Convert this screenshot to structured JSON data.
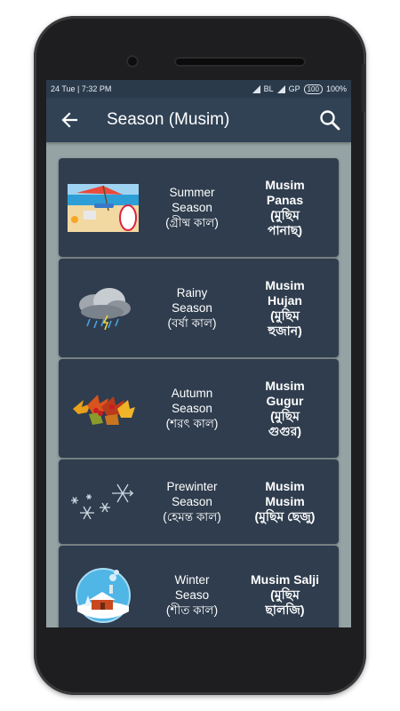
{
  "status_bar": {
    "left_text": "24 Tue | 7:32 PM",
    "carrier_1": "BL",
    "carrier_2": "GP",
    "battery_badge": "100",
    "battery_percent": "100%"
  },
  "app_bar": {
    "title": "Season (Musim)",
    "back_icon": "arrow-left",
    "search_icon": "magnifier"
  },
  "seasons": [
    {
      "image": "summer-beach-image",
      "english": [
        "Summer",
        "Season",
        "(গ্রীষ্ম কাল)"
      ],
      "name": [
        "Musim",
        "Panas",
        "(মুছিম",
        "পানাছ)"
      ]
    },
    {
      "image": "rain-cloud-image",
      "english": [
        "Rainy",
        "Season",
        "(বর্ষা কাল)"
      ],
      "name": [
        "Musim",
        "Hujan",
        "(মুছিম",
        "হুজান)"
      ]
    },
    {
      "image": "autumn-leaves-image",
      "english": [
        "Autumn",
        "Season",
        "(শরৎ কাল)"
      ],
      "name": [
        "Musim",
        "Gugur",
        "(মুছিম",
        "গুগুর)"
      ]
    },
    {
      "image": "snowflakes-image",
      "english": [
        "Prewinter",
        "Season",
        "(হেমন্ত কাল)"
      ],
      "name": [
        "Musim",
        "Musim",
        "(মুছিম ছেজু)"
      ]
    },
    {
      "image": "snow-globe-image",
      "english": [
        "Winter",
        "Seaso",
        "(শীত কাল)"
      ],
      "name": [
        "Musim Salji",
        "(মুছিম",
        "ছালজি)"
      ]
    }
  ],
  "colors": {
    "status_bar": "#2b3a4b",
    "app_bar": "#314255",
    "card": "#2f3d4e",
    "screen_background": "#96a3a5"
  }
}
